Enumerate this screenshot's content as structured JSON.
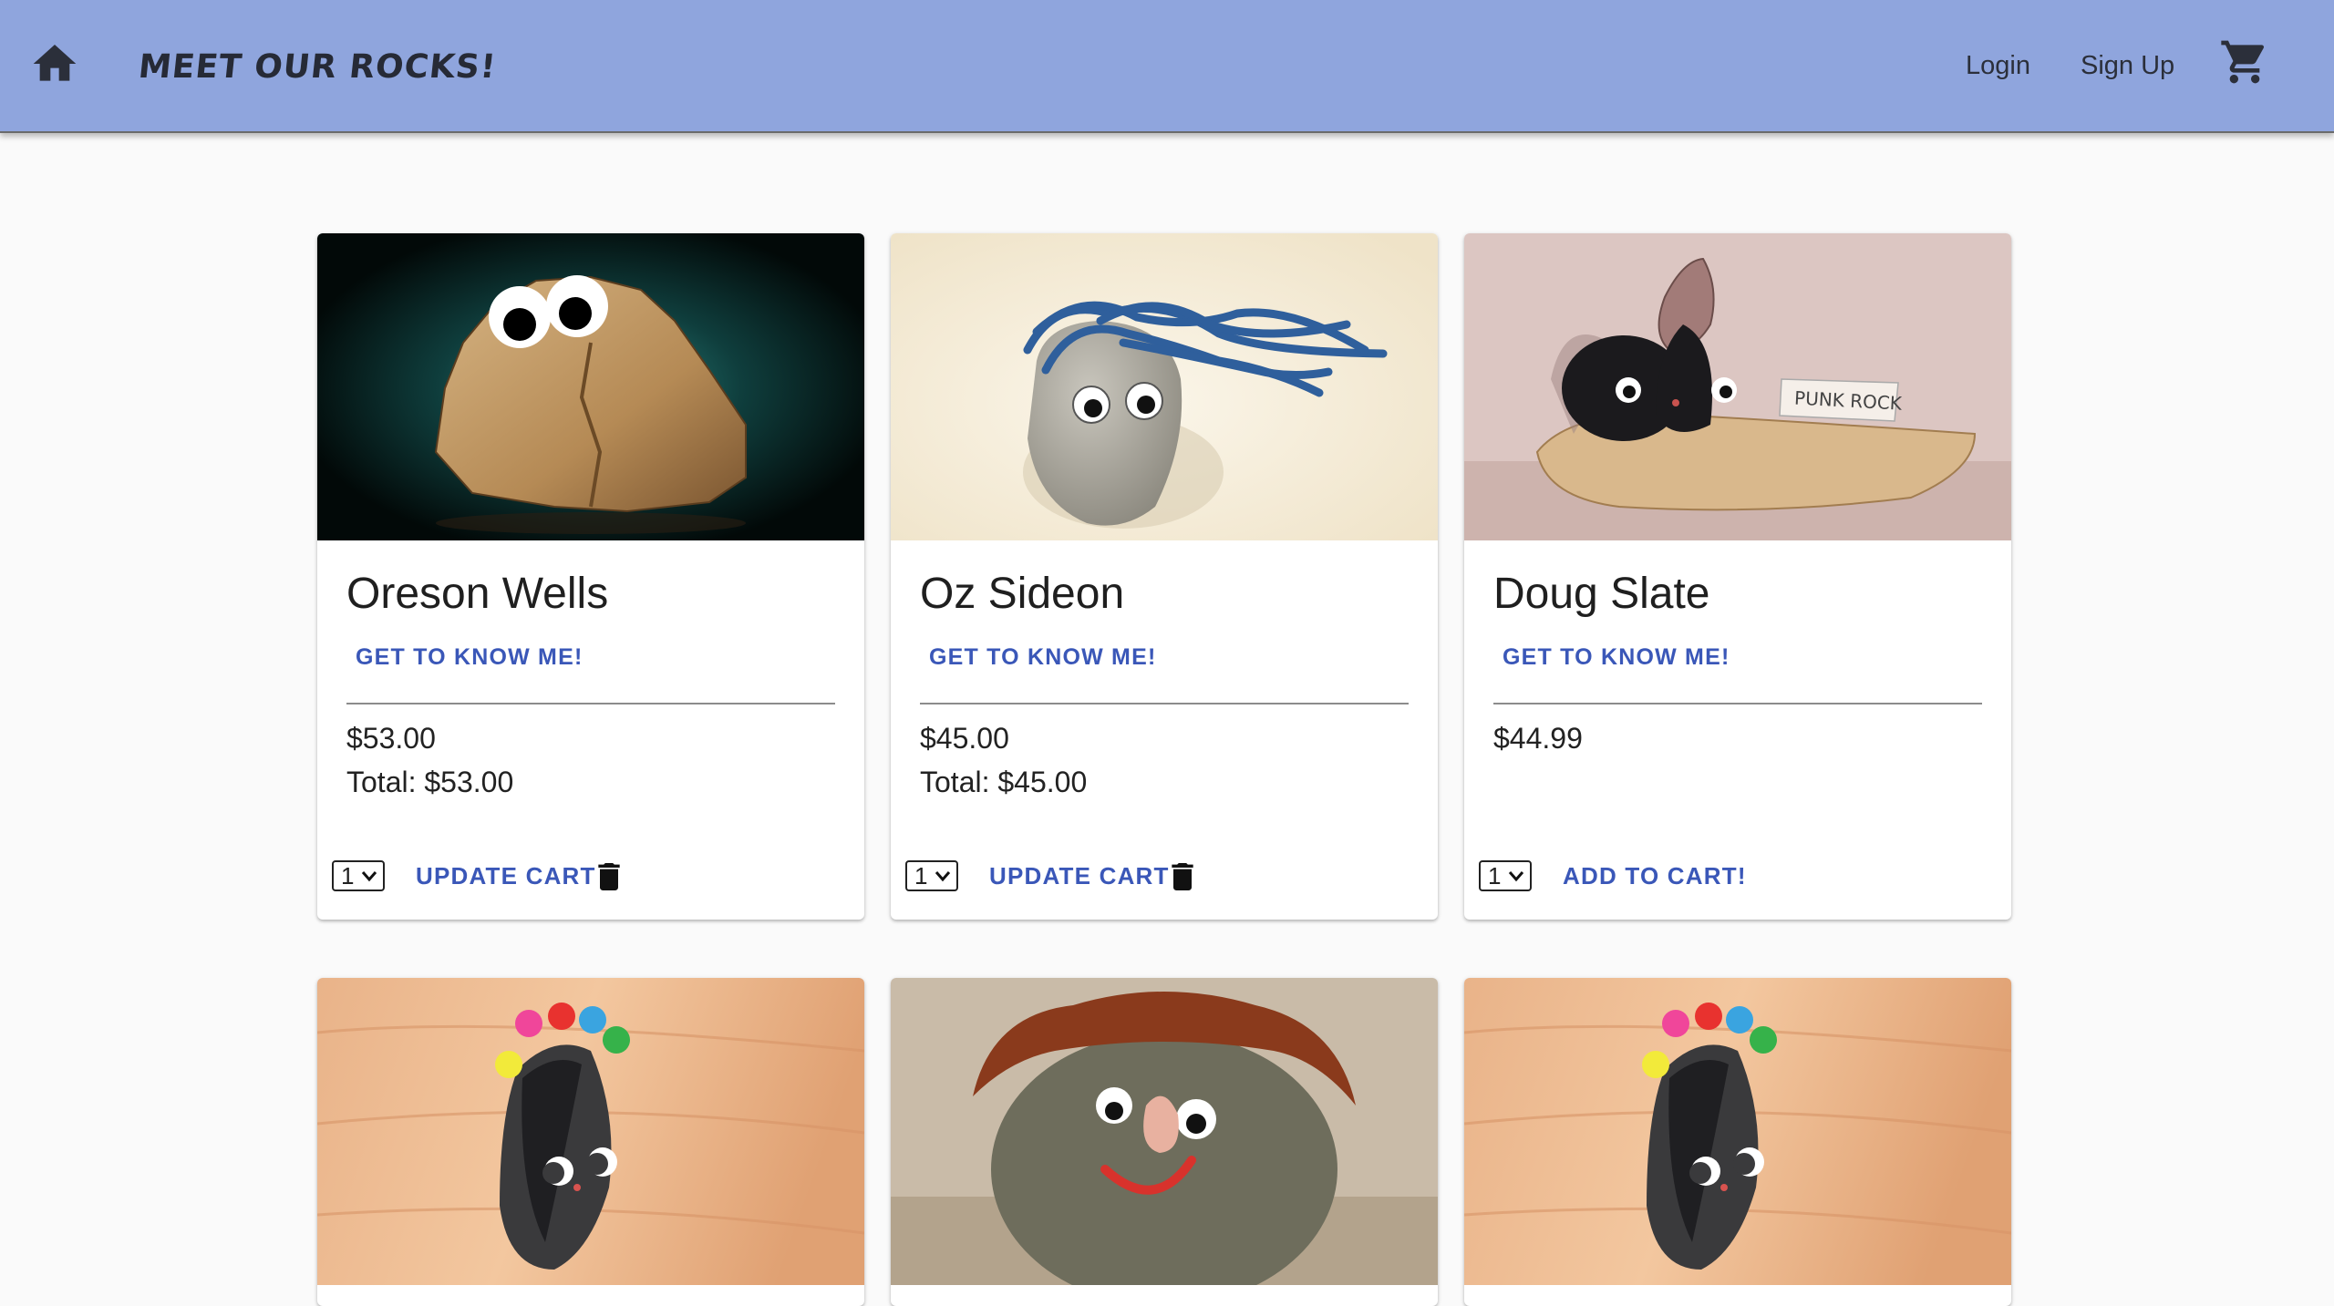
{
  "header": {
    "home_icon": "home-icon",
    "brand_text": "MEET OUR ROCKS!",
    "login_label": "Login",
    "signup_label": "Sign Up",
    "cart_icon": "shopping-cart-icon",
    "background_color": "#8fa5dd"
  },
  "accent_color": "#3a57b8",
  "products": [
    {
      "name": "Oreson Wells",
      "link_label": "GET TO KNOW ME!",
      "price": "$53.00",
      "total": "Total: $53.00",
      "quantity": "1",
      "action_label": "UPDATE CART",
      "delete_icon": "trash-icon"
    },
    {
      "name": "Oz Sideon",
      "link_label": "GET TO KNOW ME!",
      "price": "$45.00",
      "total": "Total: $45.00",
      "quantity": "1",
      "action_label": "UPDATE CART",
      "delete_icon": "trash-icon"
    },
    {
      "name": "Doug Slate",
      "link_label": "GET TO KNOW ME!",
      "price": "$44.99",
      "quantity": "1",
      "action_label": "ADD TO CART!",
      "image_sign_text": "PUNK ROCK"
    }
  ]
}
